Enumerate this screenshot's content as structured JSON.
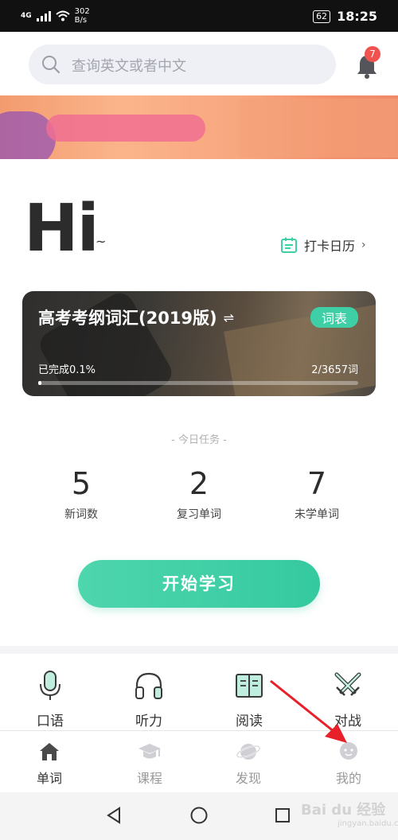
{
  "status_bar": {
    "network": "4G",
    "speed": "302\nB/s",
    "battery": "62",
    "time": "18:25"
  },
  "search": {
    "placeholder": "查询英文或者中文"
  },
  "notifications": {
    "badge_count": "7"
  },
  "greeting": {
    "title": "Hi",
    "suffix": "~"
  },
  "checkin": {
    "label": "打卡日历",
    "chevron": "›"
  },
  "wordbook": {
    "title": "高考考纲词汇(2019版)",
    "swap_glyph": "⇌",
    "tag": "词表",
    "progress_label": "已完成0.1%",
    "progress_count": "2/3657词",
    "progress_fraction": 0.001
  },
  "tasks": {
    "title": "- 今日任务 -",
    "stats": [
      {
        "value": "5",
        "label": "新词数"
      },
      {
        "value": "2",
        "label": "复习单词"
      },
      {
        "value": "7",
        "label": "未学单词"
      }
    ]
  },
  "start_button": {
    "label": "开始学习"
  },
  "features": [
    {
      "label": "口语",
      "icon": "microphone-icon"
    },
    {
      "label": "听力",
      "icon": "headphones-icon"
    },
    {
      "label": "阅读",
      "icon": "book-icon"
    },
    {
      "label": "对战",
      "icon": "crossed-swords-icon"
    }
  ],
  "tabs": [
    {
      "label": "单词",
      "icon": "home-icon",
      "active": true
    },
    {
      "label": "课程",
      "icon": "graduation-cap-icon",
      "active": false
    },
    {
      "label": "发现",
      "icon": "planet-icon",
      "active": false
    },
    {
      "label": "我的",
      "icon": "profile-icon",
      "active": false
    }
  ],
  "colors": {
    "accent": "#3fcfa6",
    "badge": "#f0524f",
    "annotation": "#e8202a"
  },
  "watermark": {
    "text": "Bai du 经验",
    "sub": "jingyan.baidu.com"
  }
}
